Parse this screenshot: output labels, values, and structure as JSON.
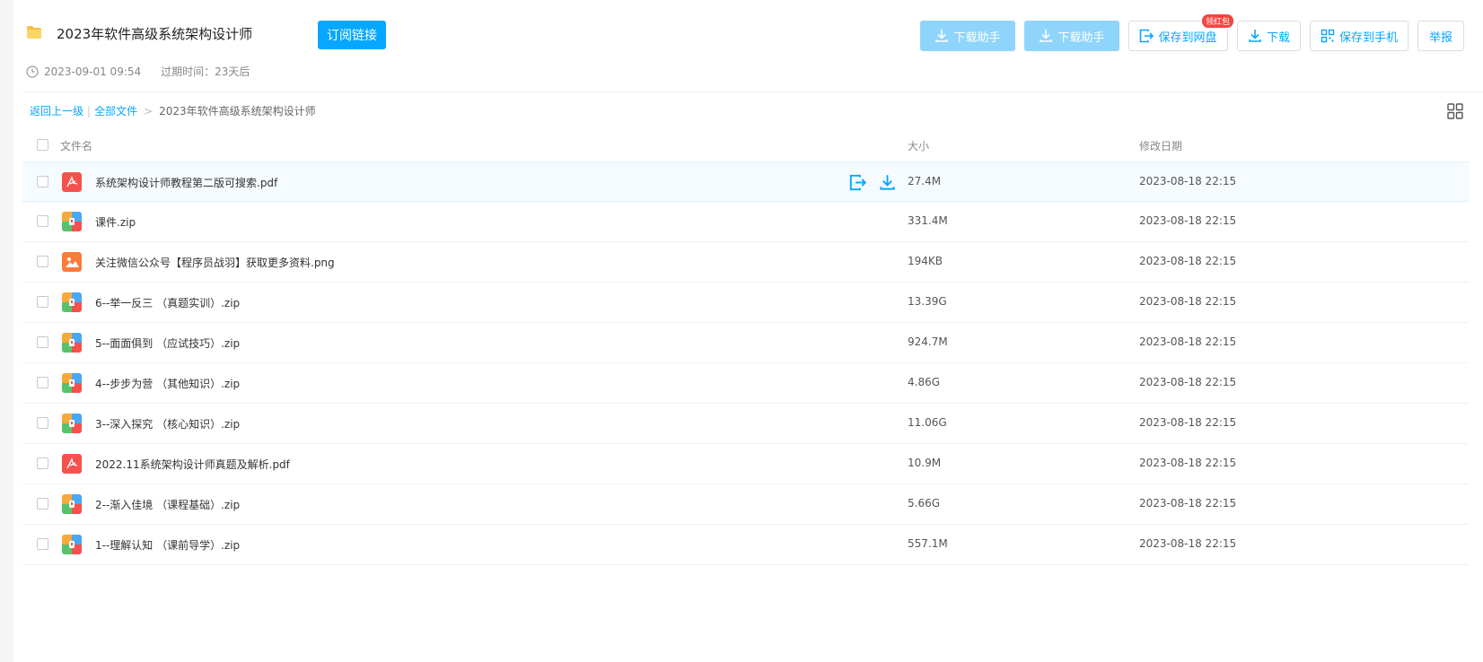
{
  "header": {
    "title": "2023年软件高级系统架构设计师",
    "subscribe_label": "订阅链接",
    "date": "2023-09-01 09:54",
    "expire": "过期时间：23天后"
  },
  "actions": {
    "helper1": "下载助手",
    "helper2": "下载助手",
    "save_disk": "保存到网盘",
    "save_disk_badge": "领红包",
    "download": "下载",
    "save_phone": "保存到手机",
    "report": "举报"
  },
  "breadcrumb": {
    "back": "返回上一级",
    "all": "全部文件",
    "arrow": ">",
    "current": "2023年软件高级系统架构设计师"
  },
  "table": {
    "col_name": "文件名",
    "col_size": "大小",
    "col_date": "修改日期"
  },
  "files": [
    {
      "name": "系统架构设计师教程第二版可搜索.pdf",
      "size": "27.4M",
      "date": "2023-08-18 22:15",
      "type": "pdf"
    },
    {
      "name": "课件.zip",
      "size": "331.4M",
      "date": "2023-08-18 22:15",
      "type": "zip"
    },
    {
      "name": "关注微信公众号【程序员战羽】获取更多资料.png",
      "size": "194KB",
      "date": "2023-08-18 22:15",
      "type": "img"
    },
    {
      "name": "6--举一反三 （真题实训）.zip",
      "size": "13.39G",
      "date": "2023-08-18 22:15",
      "type": "zip"
    },
    {
      "name": "5--面面俱到 （应试技巧）.zip",
      "size": "924.7M",
      "date": "2023-08-18 22:15",
      "type": "zip"
    },
    {
      "name": "4--步步为营 （其他知识）.zip",
      "size": "4.86G",
      "date": "2023-08-18 22:15",
      "type": "zip"
    },
    {
      "name": "3--深入探究 （核心知识）.zip",
      "size": "11.06G",
      "date": "2023-08-18 22:15",
      "type": "zip"
    },
    {
      "name": "2022.11系统架构设计师真题及解析.pdf",
      "size": "10.9M",
      "date": "2023-08-18 22:15",
      "type": "pdf"
    },
    {
      "name": "2--渐入佳境 （课程基础）.zip",
      "size": "5.66G",
      "date": "2023-08-18 22:15",
      "type": "zip"
    },
    {
      "name": "1--理解认知 （课前导学）.zip",
      "size": "557.1M",
      "date": "2023-08-18 22:15",
      "type": "zip"
    }
  ],
  "colors": {
    "accent": "#06a7ff",
    "accent_disabled": "#8fd4fb",
    "pdf": "#f5514c",
    "image": "#f97c3c",
    "badge": "#f5453f"
  },
  "icons": {
    "folder": "folder-icon",
    "clock": "clock-icon",
    "download": "download-icon",
    "save": "save-to-disk-icon",
    "qr": "qr-code-icon",
    "grid": "grid-view-icon"
  }
}
